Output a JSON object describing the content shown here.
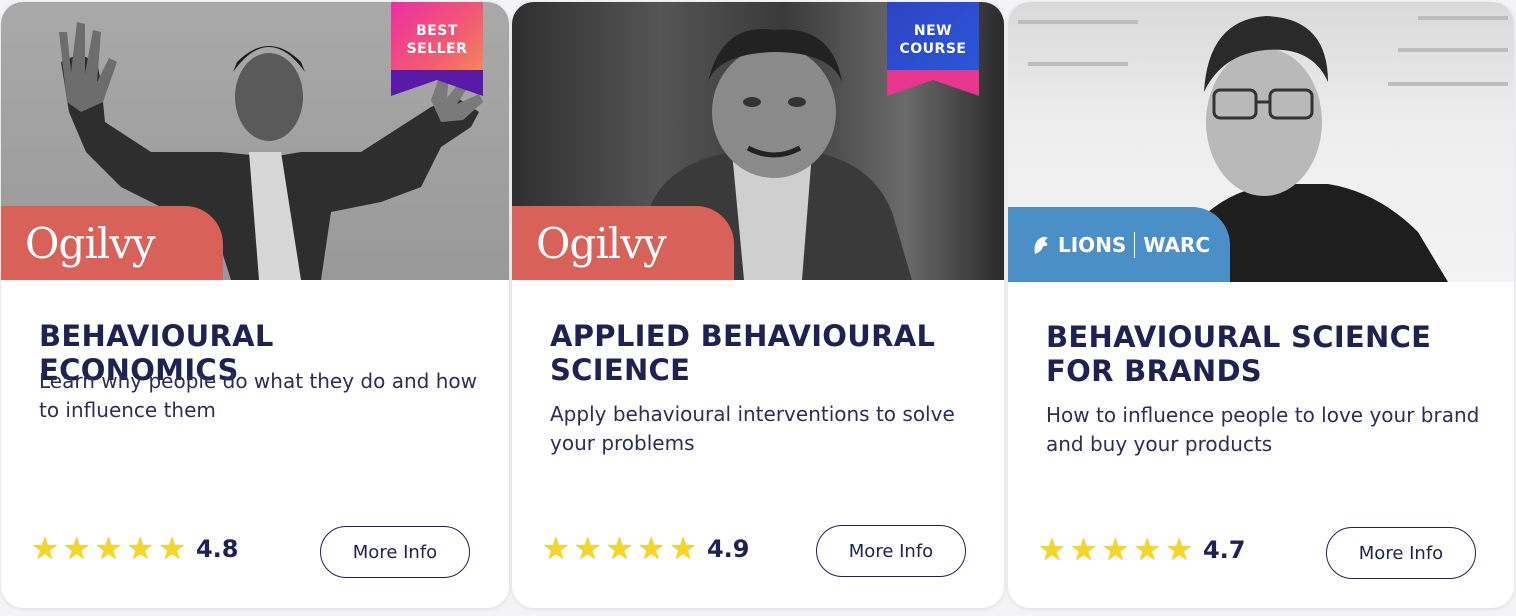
{
  "courses": [
    {
      "brand": "Ogilvy",
      "badge": [
        "BEST",
        "SELLER"
      ],
      "title": "BEHAVIOURAL ECONOMICS",
      "description": "Learn why people do what they do and how to influence them",
      "rating": "4.8",
      "stars": 5,
      "button": "More Info"
    },
    {
      "brand": "Ogilvy",
      "badge": [
        "NEW",
        "COURSE"
      ],
      "title": "APPLIED BEHAVIOURAL SCIENCE",
      "description": "Apply behavioural interventions to solve your problems",
      "rating": "4.9",
      "stars": 5,
      "button": "More Info"
    },
    {
      "brand_left": "LIONS",
      "brand_right": "WARC",
      "title": "BEHAVIOURAL SCIENCE FOR BRANDS",
      "description": "How to influence people to love your brand and buy your products",
      "rating": "4.7",
      "stars": 5,
      "button": "More Info"
    }
  ],
  "colors": {
    "heading": "#1f2250",
    "ogilvy_red": "#d8615a",
    "lions_blue": "#4a8fc6",
    "star": "#f7d528",
    "best_seller_gradient": "#ee2ea2",
    "new_course_gradient": "#2f43c4"
  },
  "icons": {
    "star": "star-icon",
    "lions_logo": "lions-logo-icon"
  }
}
